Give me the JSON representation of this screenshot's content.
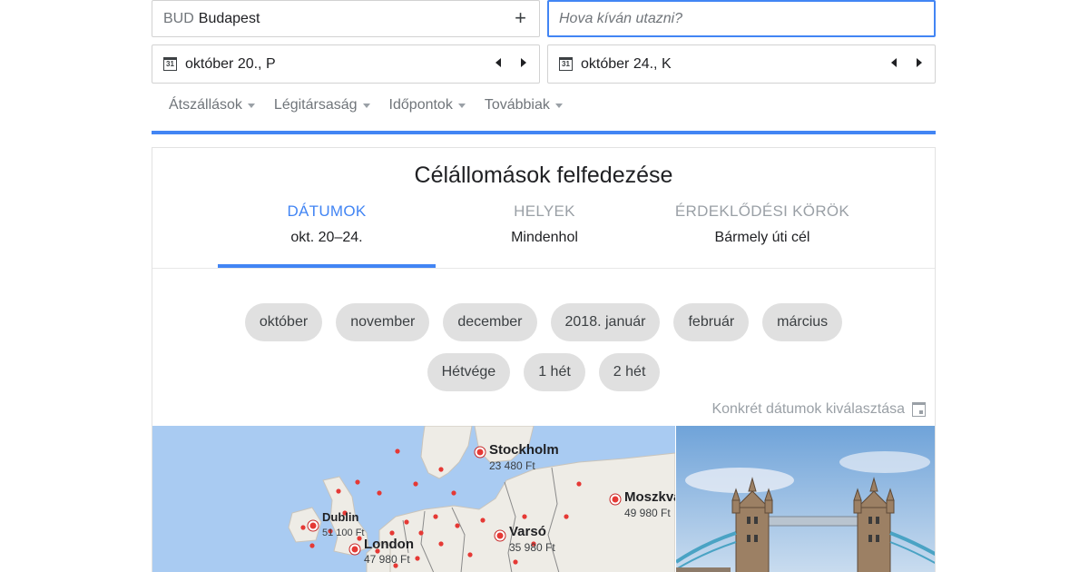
{
  "search": {
    "origin_code": "BUD",
    "origin_city": "Budapest",
    "add_label": "+",
    "destination_placeholder": "Hova kíván utazni?",
    "departure_date": "október 20., P",
    "return_date": "október 24., K",
    "calendar_icon_text": "31"
  },
  "filters": [
    "Átszállások",
    "Légitársaság",
    "Időpontok",
    "Továbbiak"
  ],
  "explore": {
    "title": "Célállomások felfedezése",
    "tabs": [
      {
        "label": "DÁTUMOK",
        "value": "okt. 20–24."
      },
      {
        "label": "HELYEK",
        "value": "Mindenhol"
      },
      {
        "label": "ÉRDEKLŐDÉSI KÖRÖK",
        "value": "Bármely úti cél"
      }
    ],
    "month_chips": [
      "október",
      "november",
      "december",
      "2018. január",
      "február",
      "március"
    ],
    "duration_chips": [
      "Hétvége",
      "1 hét",
      "2 hét"
    ],
    "specific_dates_label": "Konkrét dátumok kiválasztása"
  },
  "map": {
    "cities": [
      {
        "name": "Stockholm",
        "price": "23 480 Ft"
      },
      {
        "name": "Moszkva",
        "price": "49 980 Ft"
      },
      {
        "name": "Dublin",
        "price": "51 100 Ft"
      },
      {
        "name": "London",
        "price": "47 980 Ft"
      },
      {
        "name": "Varsó",
        "price": "35 980 Ft"
      }
    ]
  },
  "colors": {
    "accent": "#4285f4",
    "chip_bg": "#e0e0e0",
    "muted": "#9aa0a6",
    "marker": "#e53935"
  }
}
